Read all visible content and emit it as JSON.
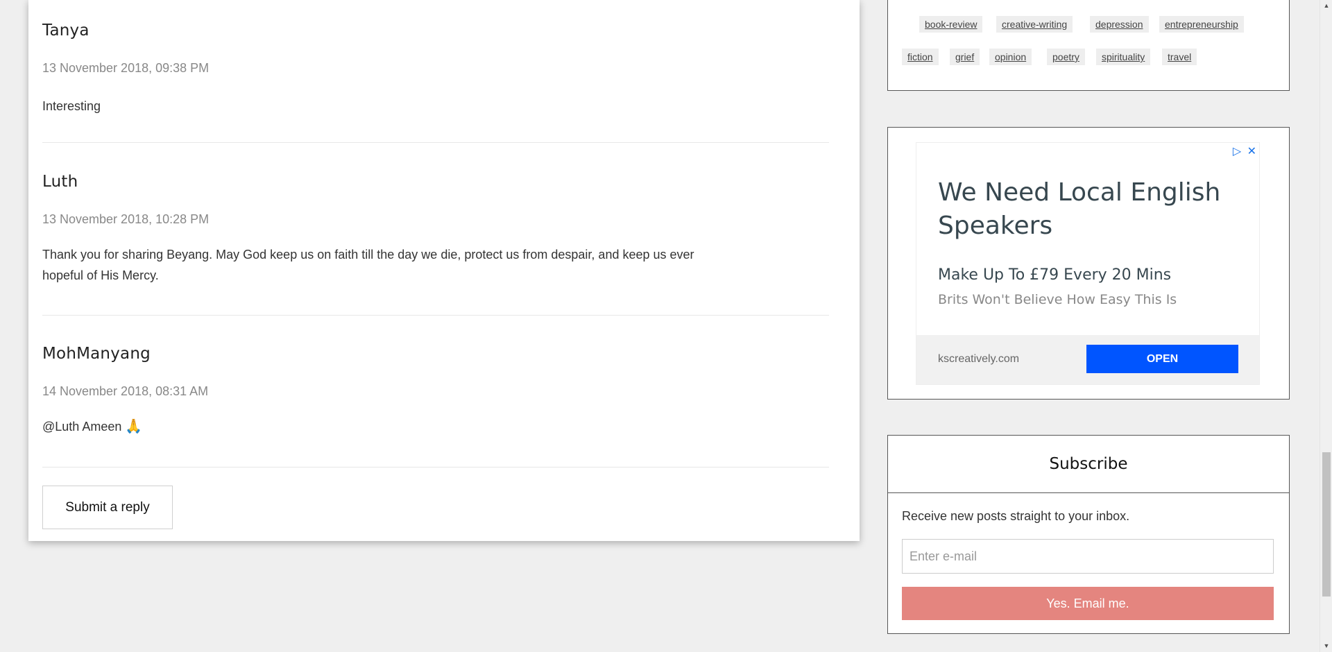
{
  "comments": [
    {
      "author": "Tanya",
      "date": "13 November 2018, 09:38 PM",
      "body": "Interesting"
    },
    {
      "author": "Luth",
      "date": "13 November 2018, 10:28 PM",
      "body": "Thank you for sharing Beyang. May God keep us on faith till the day we die, protect us from despair, and keep us ever hopeful of His Mercy."
    },
    {
      "author": "MohManyang",
      "date": "14 November 2018, 08:31 AM",
      "body": "@Luth Ameen",
      "emoji": "🙏"
    }
  ],
  "reply_button": "Submit a reply",
  "tags": [
    "book-review",
    "creative-writing",
    "depression",
    "entrepreneurship",
    "fiction",
    "grief",
    "opinion",
    "poetry",
    "spirituality",
    "travel"
  ],
  "ad": {
    "headline": "We Need Local English Speakers",
    "subheadline": "Make Up To £79 Every 20 Mins",
    "description": "Brits Won't Believe How Easy This Is",
    "domain": "kscreatively.com",
    "cta": "OPEN",
    "adchoices_icon": "▷",
    "close_icon": "✕"
  },
  "subscribe": {
    "title": "Subscribe",
    "text": "Receive new posts straight to your inbox.",
    "placeholder": "Enter e-mail",
    "button": "Yes. Email me."
  },
  "colors": {
    "accent_button": "#e4857f",
    "ad_cta": "#0055ff"
  }
}
